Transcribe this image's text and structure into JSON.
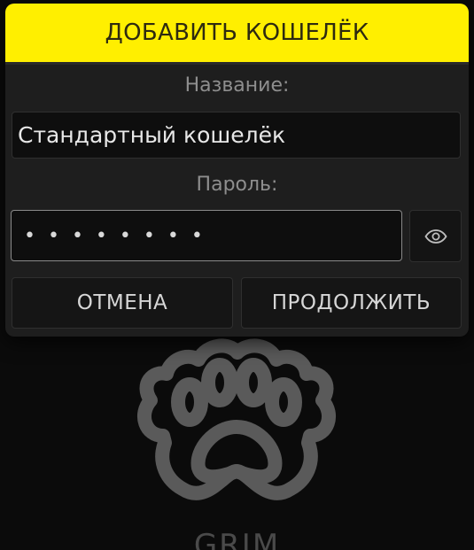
{
  "background": {
    "logo_icon": "paw-icon",
    "app_name": "GRIM"
  },
  "dialog": {
    "title": "ДОБАВИТЬ КОШЕЛЁК",
    "name_label": "Название:",
    "name_value": "Стандартный кошелёк",
    "password_label": "Пароль:",
    "password_value": "••••••••",
    "show_password_icon": "eye-icon",
    "cancel_label": "ОТМЕНА",
    "continue_label": "ПРОДОЛЖИТЬ"
  },
  "colors": {
    "header_accent": "#ffef00",
    "dialog_bg": "#1e1e1e",
    "page_bg": "#0b0b0b"
  }
}
